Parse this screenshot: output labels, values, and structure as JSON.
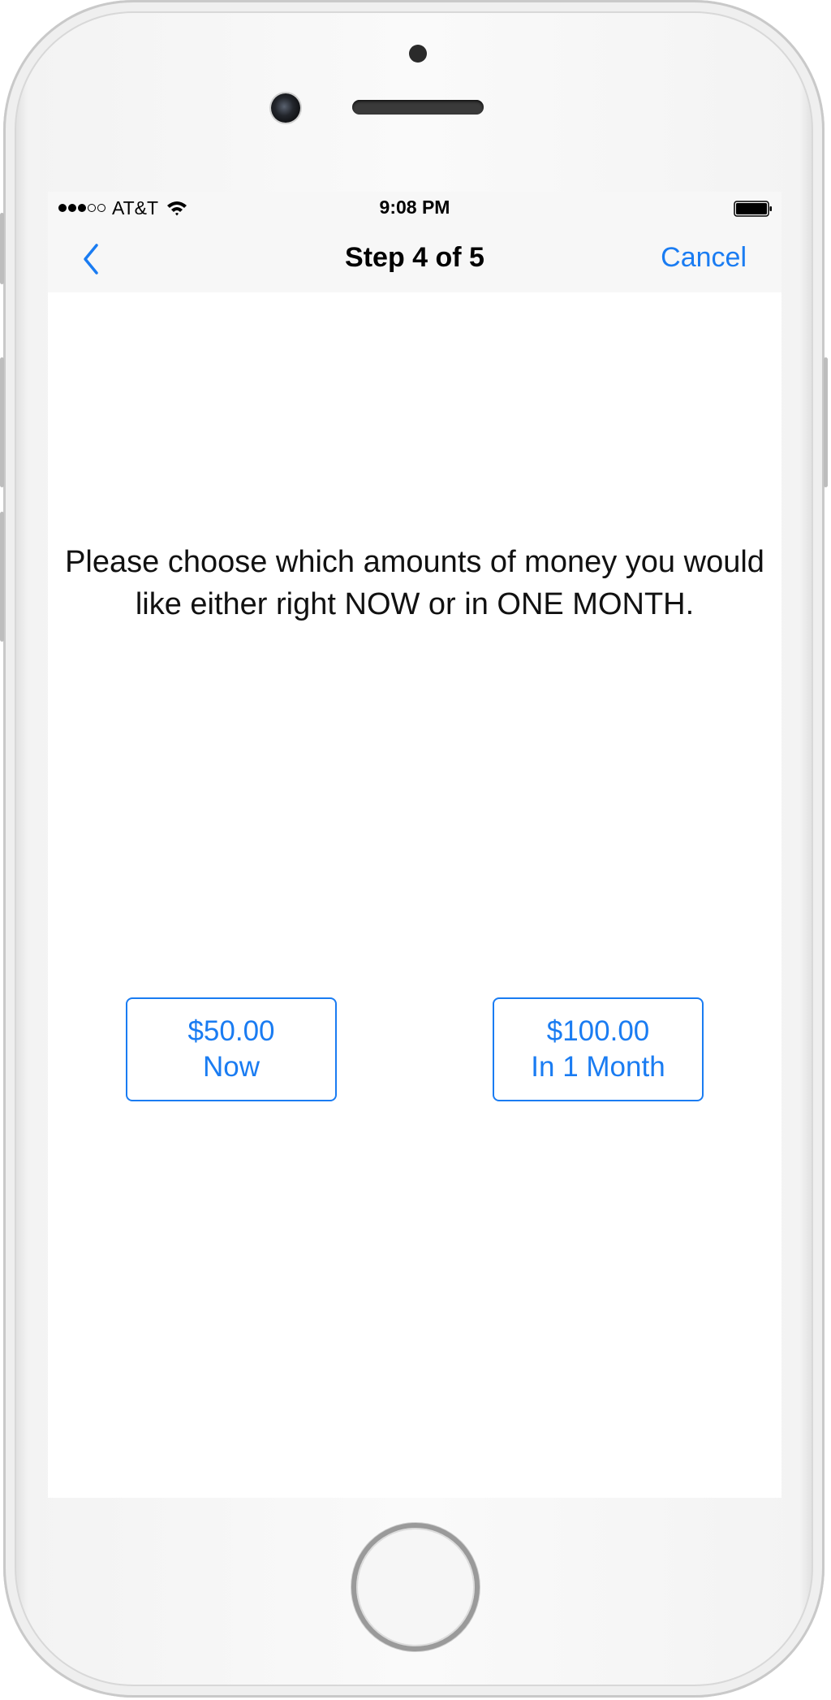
{
  "status_bar": {
    "carrier": "AT&T",
    "time": "9:08 PM",
    "signal_bars_filled": 3,
    "signal_bars_total": 5,
    "battery_level": 0.9
  },
  "nav": {
    "back_icon": "chevron-left-icon",
    "title": "Step 4 of 5",
    "cancel_label": "Cancel"
  },
  "main": {
    "prompt": "Please choose which amounts of money you would like either right NOW or in ONE MONTH."
  },
  "choices": [
    {
      "amount": "$50.00",
      "when": "Now"
    },
    {
      "amount": "$100.00",
      "when": "In 1 Month"
    }
  ],
  "colors": {
    "accent": "#1a7cf2",
    "bar_background": "#f7f7f7"
  }
}
